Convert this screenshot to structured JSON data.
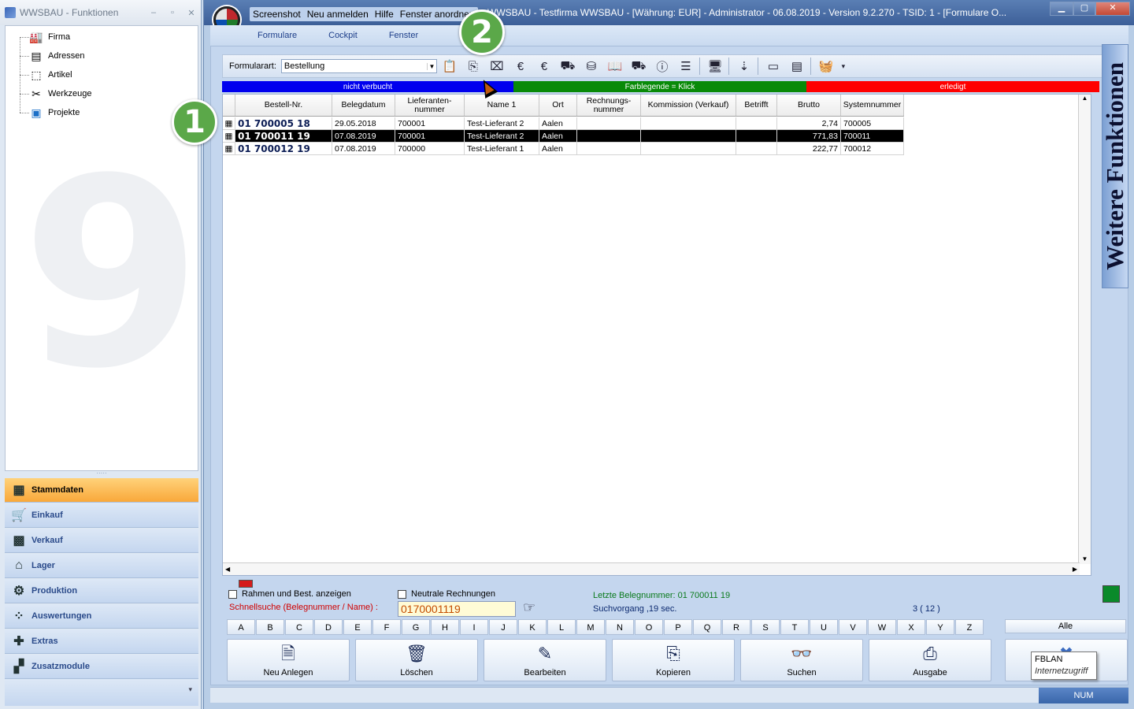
{
  "left_window": {
    "title": "WWSBAU - Funktionen",
    "tree": [
      {
        "label": "Firma",
        "icon": "factory-icon"
      },
      {
        "label": "Adressen",
        "icon": "address-card-icon"
      },
      {
        "label": "Artikel",
        "icon": "box-icon"
      },
      {
        "label": "Werkzeuge",
        "icon": "tools-icon"
      },
      {
        "label": "Projekte",
        "icon": "project-icon"
      }
    ],
    "nav": [
      {
        "label": "Stammdaten",
        "icon": "master-data-icon",
        "active": true
      },
      {
        "label": "Einkauf",
        "icon": "cart-icon"
      },
      {
        "label": "Verkauf",
        "icon": "cash-register-icon"
      },
      {
        "label": "Lager",
        "icon": "warehouse-icon"
      },
      {
        "label": "Produktion",
        "icon": "production-icon"
      },
      {
        "label": "Auswertungen",
        "icon": "analytics-icon"
      },
      {
        "label": "Extras",
        "icon": "extras-icon"
      },
      {
        "label": "Zusatzmodule",
        "icon": "modules-icon"
      }
    ]
  },
  "main_window": {
    "title_menus": [
      "Screenshot",
      "Neu anmelden",
      "Hilfe",
      "Fenster anordnen"
    ],
    "title": "WWSBAU - Testfirma WWSBAU - [Währung: EUR] - Administrator - 06.08.2019 - Version 9.2.270 - TSID: 1 - [Formulare O...",
    "menubar": [
      "Formulare",
      "Cockpit",
      "Fenster"
    ]
  },
  "toolbar": {
    "formart_label": "Formularart:",
    "formart_value": "Bestellung"
  },
  "legend": {
    "blue": "nicht verbucht",
    "green": "Farblegende = Klick",
    "red": "erledigt",
    "colors": {
      "blue": "#0000ee",
      "green": "#088a08",
      "red": "#ff0000"
    }
  },
  "grid": {
    "headers": [
      "",
      "Bestell-Nr.",
      "Belegdatum",
      "Lieferanten-nummer",
      "Name 1",
      "Ort",
      "Rechnungs-nummer",
      "Kommission (Verkauf)",
      "Betrifft",
      "Brutto",
      "Systemnummer"
    ],
    "rows": [
      {
        "bestellnr": "01 700005 18",
        "datum": "29.05.2018",
        "lief": "700001",
        "name": "Test-Lieferant 2",
        "ort": "Aalen",
        "rechnr": "",
        "komm": "",
        "betrifft": "",
        "brutto": "2,74",
        "sysnr": "700005"
      },
      {
        "bestellnr": "01 700011 19",
        "datum": "07.08.2019",
        "lief": "700001",
        "name": "Test-Lieferant 2",
        "ort": "Aalen",
        "rechnr": "",
        "komm": "",
        "betrifft": "",
        "brutto": "771,83",
        "sysnr": "700011"
      },
      {
        "bestellnr": "01 700012 19",
        "datum": "07.08.2019",
        "lief": "700000",
        "name": "Test-Lieferant 1",
        "ort": "Aalen",
        "rechnr": "",
        "komm": "",
        "betrifft": "",
        "brutto": "222,77",
        "sysnr": "700012"
      }
    ]
  },
  "side_tab": "Weitere Funktionen",
  "bottom": {
    "chk_rahmen": "Rahmen und Best. anzeigen",
    "chk_neutral": "Neutrale Rechnungen",
    "quick_label": "Schnellsuche (Belegnummer / Name) :",
    "quick_value": "0170001119",
    "last_number": "Letzte Belegnummer: 01 700011 19",
    "search_time": "Suchvorgang ,19 sec.",
    "count": "3 ( 12 )",
    "alphabet": [
      "A",
      "B",
      "C",
      "D",
      "E",
      "F",
      "G",
      "H",
      "I",
      "J",
      "K",
      "L",
      "M",
      "N",
      "O",
      "P",
      "Q",
      "R",
      "S",
      "T",
      "U",
      "V",
      "W",
      "X",
      "Y",
      "Z"
    ],
    "alle": "Alle",
    "buttons": [
      {
        "label": "Neu Anlegen",
        "icon": "new-document-icon"
      },
      {
        "label": "Löschen",
        "icon": "trash-icon"
      },
      {
        "label": "Bearbeiten",
        "icon": "edit-icon"
      },
      {
        "label": "Kopieren",
        "icon": "copy-icon"
      },
      {
        "label": "Suchen",
        "icon": "binoculars-icon"
      },
      {
        "label": "Ausgabe",
        "icon": "printer-icon"
      }
    ],
    "tooltip_title": "FBLAN",
    "tooltip_sub": "Internetzugriff"
  },
  "statusbar": {
    "num": "NUM"
  },
  "callouts": [
    "1",
    "2"
  ]
}
